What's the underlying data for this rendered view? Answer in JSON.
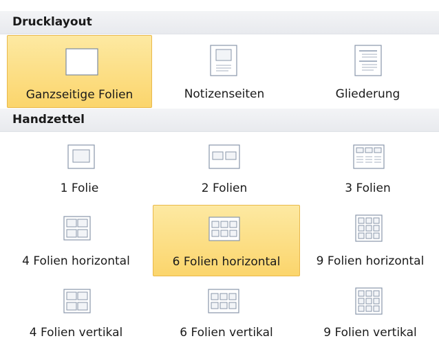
{
  "sections": {
    "print_layout": {
      "title": "Drucklayout",
      "items": [
        {
          "label": "Ganzseitige Folien",
          "icon": "full-page-slide-icon",
          "selected": true
        },
        {
          "label": "Notizenseiten",
          "icon": "notes-page-icon",
          "selected": false
        },
        {
          "label": "Gliederung",
          "icon": "outline-icon",
          "selected": false
        }
      ]
    },
    "handouts": {
      "title": "Handzettel",
      "items": [
        {
          "label": "1 Folie",
          "icon": "one-slide-icon",
          "selected": false
        },
        {
          "label": "2 Folien",
          "icon": "two-slides-icon",
          "selected": false
        },
        {
          "label": "3 Folien",
          "icon": "three-slides-icon",
          "selected": false
        },
        {
          "label": "4 Folien horizontal",
          "icon": "four-slides-horizontal-icon",
          "selected": false
        },
        {
          "label": "6 Folien horizontal",
          "icon": "six-slides-horizontal-icon",
          "selected": true
        },
        {
          "label": "9 Folien horizontal",
          "icon": "nine-slides-horizontal-icon",
          "selected": false
        },
        {
          "label": "4 Folien vertikal",
          "icon": "four-slides-vertical-icon",
          "selected": false
        },
        {
          "label": "6 Folien vertikal",
          "icon": "six-slides-vertical-icon",
          "selected": false
        },
        {
          "label": "9 Folien vertikal",
          "icon": "nine-slides-vertical-icon",
          "selected": false
        }
      ]
    }
  },
  "colors": {
    "selected_fill": "#fbd56c",
    "selected_border": "#e9b84a",
    "header_bg": "#eceef1"
  }
}
